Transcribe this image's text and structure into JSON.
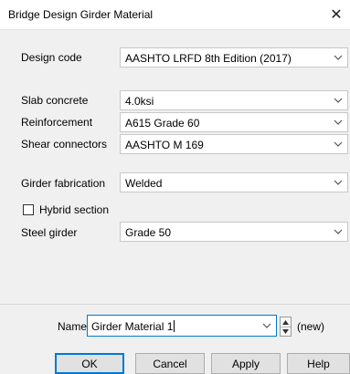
{
  "window": {
    "title": "Bridge Design Girder Material",
    "close_glyph": "✕"
  },
  "fields": {
    "design_code": {
      "label": "Design code",
      "value": "AASHTO LRFD 8th Edition (2017)"
    },
    "slab_concrete": {
      "label": "Slab concrete",
      "value": "4.0ksi"
    },
    "reinforcement": {
      "label": "Reinforcement",
      "value": "A615 Grade 60"
    },
    "shear_connectors": {
      "label": "Shear connectors",
      "value": "AASHTO M 169"
    },
    "girder_fabrication": {
      "label": "Girder fabrication",
      "value": "Welded"
    },
    "hybrid_section": {
      "label": "Hybrid section",
      "checked": false
    },
    "steel_girder": {
      "label": "Steel girder",
      "value": "Grade 50"
    }
  },
  "name_row": {
    "label": "Name",
    "value": "Girder Material 1",
    "status": "(new)"
  },
  "buttons": {
    "ok": "OK",
    "cancel": "Cancel",
    "apply": "Apply",
    "help": "Help"
  },
  "icons": {
    "dropdown": "chevron-down-icon",
    "close": "close-icon",
    "spin_up": "spin-up-icon",
    "spin_down": "spin-down-icon"
  },
  "colors": {
    "focus_border": "#0078d7",
    "dialog_bg": "#f0f0f0"
  }
}
